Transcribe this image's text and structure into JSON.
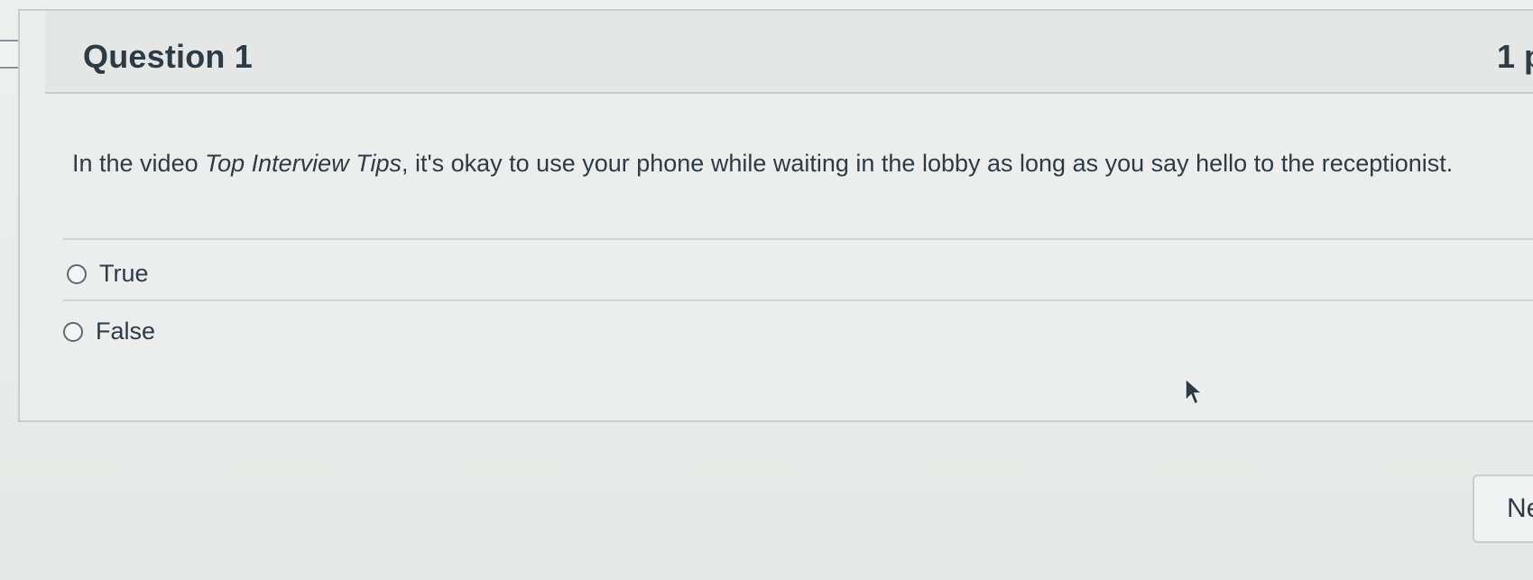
{
  "question": {
    "title": "Question 1",
    "points": "1 p",
    "text_before": "In the video ",
    "text_italic": "Top Interview Tips",
    "text_after": ", it's okay to use your phone while waiting in the lobby as long as you say hello to the receptionist.",
    "answers": [
      {
        "label": "True",
        "selected": false
      },
      {
        "label": "False",
        "selected": false
      }
    ]
  },
  "navigation": {
    "next_label": "Ne"
  },
  "icons": {
    "flag": "question-flag-icon",
    "cursor": "mouse-pointer-icon"
  }
}
